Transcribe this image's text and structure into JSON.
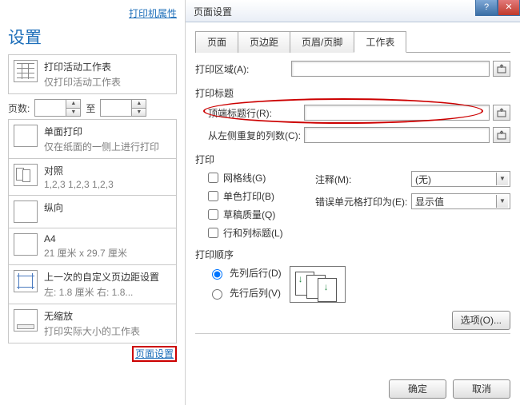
{
  "left": {
    "printerPropsLink": "打印机属性",
    "settingsTitle": "设置",
    "cards": [
      {
        "title": "打印活动工作表",
        "sub": "仅打印活动工作表"
      },
      {
        "title": "单面打印",
        "sub": "仅在纸面的一侧上进行打印"
      },
      {
        "title": "对照",
        "sub": "1,2,3    1,2,3    1,2,3"
      },
      {
        "title": "纵向",
        "sub": ""
      },
      {
        "title": "A4",
        "sub": "21 厘米 x 29.7 厘米"
      },
      {
        "title": "上一次的自定义页边距设置",
        "sub": "左: 1.8 厘米   右: 1.8..."
      },
      {
        "title": "无缩放",
        "sub": "打印实际大小的工作表"
      }
    ],
    "pages": {
      "label": "页数:",
      "to": "至",
      "from": "",
      "toVal": ""
    },
    "pageSetupLink": "页面设置"
  },
  "dialog": {
    "title": "页面设置",
    "tabs": [
      "页面",
      "页边距",
      "页眉/页脚",
      "工作表"
    ],
    "selectedTab": 3,
    "printArea": {
      "label": "打印区域(A):",
      "value": ""
    },
    "printTitlesGroup": "打印标题",
    "topRows": {
      "label": "顶端标题行(R):",
      "value": ""
    },
    "leftCols": {
      "label": "从左侧重复的列数(C):",
      "value": ""
    },
    "printGroup": "打印",
    "checks": {
      "gridlines": "网格线(G)",
      "bw": "单色打印(B)",
      "draft": "草稿质量(Q)",
      "rowcol": "行和列标题(L)"
    },
    "comments": {
      "label": "注释(M):",
      "value": "(无)"
    },
    "errors": {
      "label": "错误单元格打印为(E):",
      "value": "显示值"
    },
    "orderGroup": "打印顺序",
    "radios": {
      "downover": "先列后行(D)",
      "overdown": "先行后列(V)"
    },
    "buttons": {
      "options": "选项(O)...",
      "ok": "确定",
      "cancel": "取消"
    }
  }
}
